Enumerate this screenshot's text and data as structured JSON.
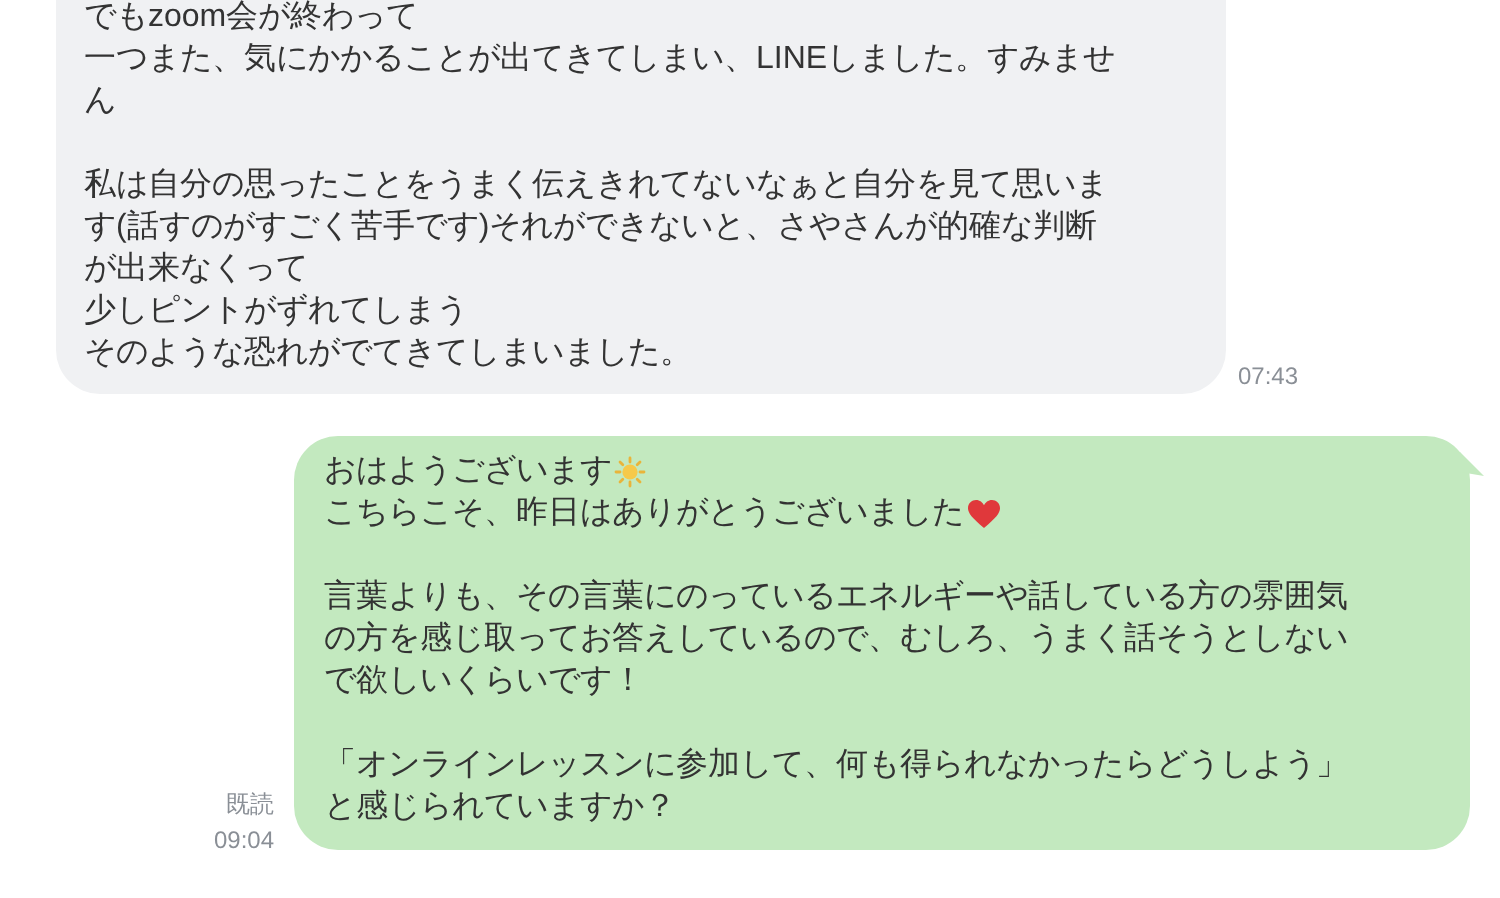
{
  "messages": [
    {
      "kind": "incoming",
      "time": "07:43",
      "paragraphs": [
        [
          {
            "text": "でもzoom会が終わって",
            "kind": "plain"
          },
          {
            "text": "一つまた、気にかかることが出てきてしまい、LINEしました。すみませ",
            "kind": "plain"
          },
          {
            "text": "ん",
            "kind": "plain"
          }
        ],
        [
          {
            "text": "私は自分の思ったことをうまく伝えきれてないなぁと自分を見て思いま",
            "kind": "plain"
          },
          {
            "text": "す(話すのがすごく苦手です)それができないと、さやさんが的確な判断",
            "kind": "plain"
          },
          {
            "text": "が出来なくって",
            "kind": "plain"
          },
          {
            "text": "少しピントがずれてしまう",
            "kind": "plain"
          },
          {
            "text": "そのような恐れがでてきてしまいました。",
            "kind": "plain"
          }
        ]
      ]
    },
    {
      "kind": "outgoing",
      "read_label": "既読",
      "time": "09:04",
      "paragraphs": [
        [
          {
            "text": "おはようございます",
            "kind": "sun"
          },
          {
            "text": "こちらこそ、昨日はありがとうございました",
            "kind": "heart"
          }
        ],
        [
          {
            "text": "言葉よりも、その言葉にのっているエネルギーや話している方の雰囲気",
            "kind": "plain"
          },
          {
            "text": "の方を感じ取ってお答えしているので、むしろ、うまく話そうとしない",
            "kind": "plain"
          },
          {
            "text": "で欲しいくらいです！",
            "kind": "plain"
          }
        ],
        [
          {
            "text": "「オンラインレッスンに参加して、何も得られなかったらどうしよう」",
            "kind": "plain"
          },
          {
            "text": "と感じられていますか？",
            "kind": "plain"
          }
        ]
      ]
    }
  ]
}
